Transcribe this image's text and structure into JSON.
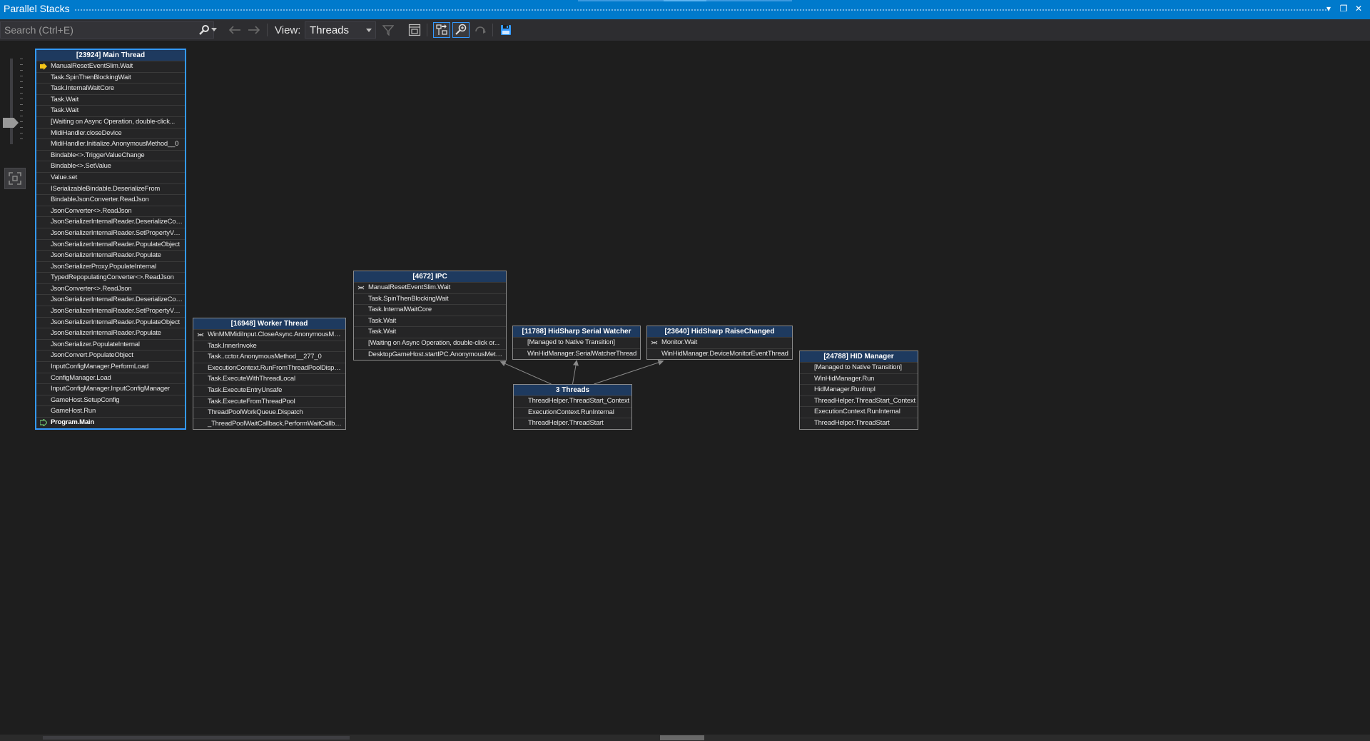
{
  "window": {
    "title": "Parallel Stacks",
    "dropdown_glyph": "▾",
    "restore_glyph": "❐",
    "close_glyph": "✕"
  },
  "toolbar": {
    "search_placeholder": "Search (Ctrl+E)",
    "view_label": "View:",
    "view_value": "Threads"
  },
  "colors": {
    "accent": "#007acc",
    "header": "#1e3a5f",
    "selected_border": "#3399ff"
  },
  "nodes": [
    {
      "id": "main",
      "header": "[23924] Main Thread",
      "selected": true,
      "frames": [
        {
          "text": "ManualResetEventSlim.Wait",
          "icon": "current-frame-arrow-icon"
        },
        {
          "text": "Task.SpinThenBlockingWait"
        },
        {
          "text": "Task.InternalWaitCore"
        },
        {
          "text": "Task.Wait"
        },
        {
          "text": "Task.Wait"
        },
        {
          "text": "[Waiting on Async Operation, double-click..."
        },
        {
          "text": "MidiHandler.closeDevice"
        },
        {
          "text": "MidiHandler.Initialize.AnonymousMethod__0"
        },
        {
          "text": "Bindable<>.TriggerValueChange"
        },
        {
          "text": "Bindable<>.SetValue"
        },
        {
          "text": "Value.set"
        },
        {
          "text": "ISerializableBindable.DeserializeFrom"
        },
        {
          "text": "BindableJsonConverter.ReadJson"
        },
        {
          "text": "JsonConverter<>.ReadJson"
        },
        {
          "text": "JsonSerializerInternalReader.DeserializeConv..."
        },
        {
          "text": "JsonSerializerInternalReader.SetPropertyValue"
        },
        {
          "text": "JsonSerializerInternalReader.PopulateObject"
        },
        {
          "text": "JsonSerializerInternalReader.Populate"
        },
        {
          "text": "JsonSerializerProxy.PopulateInternal"
        },
        {
          "text": "TypedRepopulatingConverter<>.ReadJson"
        },
        {
          "text": "JsonConverter<>.ReadJson"
        },
        {
          "text": "JsonSerializerInternalReader.DeserializeConv..."
        },
        {
          "text": "JsonSerializerInternalReader.SetPropertyValue"
        },
        {
          "text": "JsonSerializerInternalReader.PopulateObject"
        },
        {
          "text": "JsonSerializerInternalReader.Populate"
        },
        {
          "text": "JsonSerializer.PopulateInternal"
        },
        {
          "text": "JsonConvert.PopulateObject"
        },
        {
          "text": "InputConfigManager.PerformLoad"
        },
        {
          "text": "ConfigManager.Load"
        },
        {
          "text": "InputConfigManager.InputConfigManager"
        },
        {
          "text": "GameHost.SetupConfig"
        },
        {
          "text": "GameHost.Run"
        },
        {
          "text": "Program.Main",
          "bold": true,
          "icon": "thread-context-icon"
        }
      ]
    },
    {
      "id": "worker",
      "header": "[16948] Worker Thread",
      "frames": [
        {
          "text": "WinMMMidiInput.CloseAsync.AnonymousMeth...",
          "icon": "managed-native-icon"
        },
        {
          "text": "Task.InnerInvoke"
        },
        {
          "text": "Task..cctor.AnonymousMethod__277_0"
        },
        {
          "text": "ExecutionContext.RunFromThreadPoolDispat..."
        },
        {
          "text": "Task.ExecuteWithThreadLocal"
        },
        {
          "text": "Task.ExecuteEntryUnsafe"
        },
        {
          "text": "Task.ExecuteFromThreadPool"
        },
        {
          "text": "ThreadPoolWorkQueue.Dispatch"
        },
        {
          "text": "_ThreadPoolWaitCallback.PerformWaitCallback"
        }
      ]
    },
    {
      "id": "ipc",
      "header": "[4672] IPC",
      "frames": [
        {
          "text": "ManualResetEventSlim.Wait",
          "icon": "managed-native-icon"
        },
        {
          "text": "Task.SpinThenBlockingWait"
        },
        {
          "text": "Task.InternalWaitCore"
        },
        {
          "text": "Task.Wait"
        },
        {
          "text": "Task.Wait"
        },
        {
          "text": "[Waiting on Async Operation, double-click or..."
        },
        {
          "text": "DesktopGameHost.startIPC.AnonymousMeth..."
        }
      ]
    },
    {
      "id": "serial",
      "header": "[11788] HidSharp Serial Watcher",
      "frames": [
        {
          "text": "[Managed to Native Transition]"
        },
        {
          "text": "WinHidManager.SerialWatcherThread"
        }
      ]
    },
    {
      "id": "raise",
      "header": "[23640] HidSharp RaiseChanged",
      "frames": [
        {
          "text": "Monitor.Wait",
          "icon": "managed-native-icon"
        },
        {
          "text": "WinHidManager.DeviceMonitorEventThread"
        }
      ]
    },
    {
      "id": "three",
      "header": "3 Threads",
      "frames": [
        {
          "text": "ThreadHelper.ThreadStart_Context"
        },
        {
          "text": "ExecutionContext.RunInternal"
        },
        {
          "text": "ThreadHelper.ThreadStart"
        }
      ]
    },
    {
      "id": "hidmgr",
      "header": "[24788] HID Manager",
      "frames": [
        {
          "text": "[Managed to Native Transition]"
        },
        {
          "text": "WinHidManager.Run"
        },
        {
          "text": "HidManager.RunImpl"
        },
        {
          "text": "ThreadHelper.ThreadStart_Context"
        },
        {
          "text": "ExecutionContext.RunInternal"
        },
        {
          "text": "ThreadHelper.ThreadStart"
        }
      ]
    }
  ],
  "edges": [
    {
      "from": "three",
      "to": "ipc"
    },
    {
      "from": "three",
      "to": "serial"
    },
    {
      "from": "three",
      "to": "raise"
    }
  ]
}
